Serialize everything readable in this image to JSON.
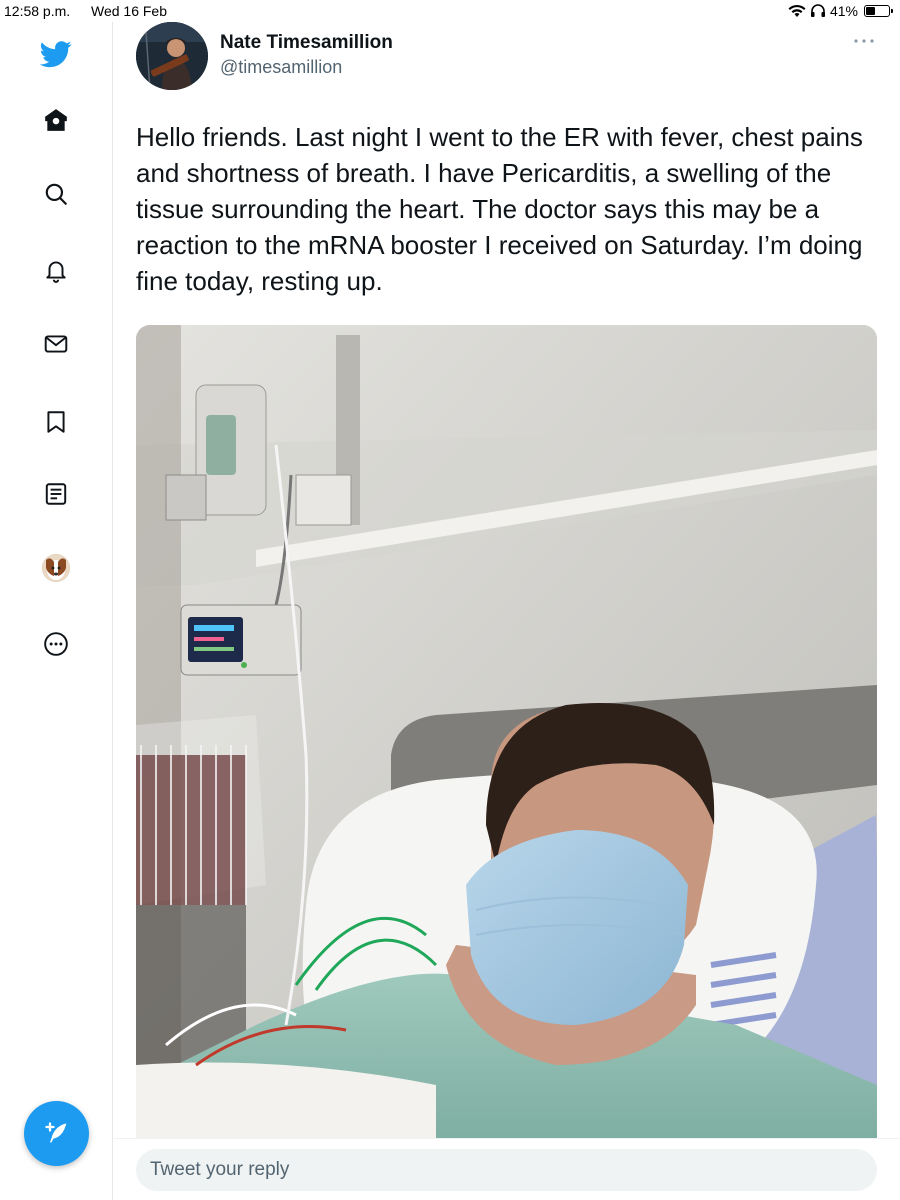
{
  "status_bar": {
    "time": "12:58 p.m.",
    "date": "Wed 16 Feb",
    "battery": "41%",
    "battery_level": 0.41
  },
  "sidebar": {
    "items": [
      {
        "icon": "twitter-logo-icon"
      },
      {
        "icon": "home-icon"
      },
      {
        "icon": "search-icon"
      },
      {
        "icon": "notifications-bell-icon"
      },
      {
        "icon": "messages-envelope-icon"
      },
      {
        "icon": "bookmark-icon"
      },
      {
        "icon": "lists-icon"
      },
      {
        "icon": "profile-avatar"
      },
      {
        "icon": "more-options-icon"
      }
    ],
    "compose_icon": "compose-tweet-icon"
  },
  "colors": {
    "accent": "#1d9bf0",
    "text_primary": "#0f1419",
    "text_secondary": "#536471"
  },
  "tweet": {
    "author_name": "Nate Timesamillion",
    "author_handle": "@timesamillion",
    "text": "Hello friends. Last night I went to the ER with fever, chest pains and shortness of breath. I have Pericarditis, a swelling of the tissue surrounding the heart. The doctor says this may be a reaction to the mRNA booster I received on Saturday. I’m doing fine today, resting up."
  },
  "reply": {
    "placeholder": "Tweet your reply"
  }
}
